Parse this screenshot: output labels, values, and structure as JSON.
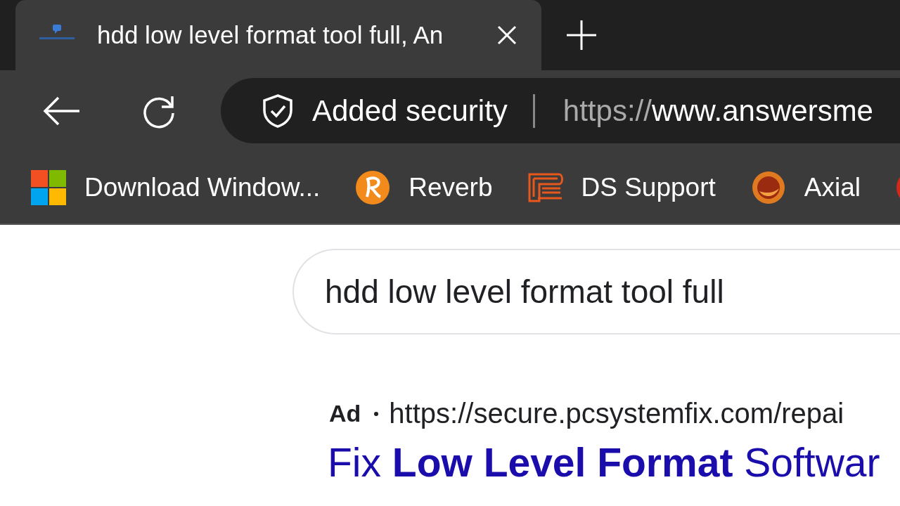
{
  "tab": {
    "title": "hdd low level format tool full, An",
    "selected": true
  },
  "toolbar": {
    "security_label": "Added security",
    "url_scheme": "https://",
    "url_host": "www.answersme"
  },
  "bookmarks": [
    {
      "kind": "windows",
      "label": "Download Window..."
    },
    {
      "kind": "reverb",
      "label": "Reverb"
    },
    {
      "kind": "ds",
      "label": "DS Support"
    },
    {
      "kind": "axial",
      "label": "Axial"
    },
    {
      "kind": "red"
    }
  ],
  "search": {
    "query": "hdd low level format tool full"
  },
  "ad": {
    "label": "Ad",
    "url": "https://secure.pcsystemfix.com/repai",
    "title": "Fix **Low Level Format** Softwar"
  }
}
